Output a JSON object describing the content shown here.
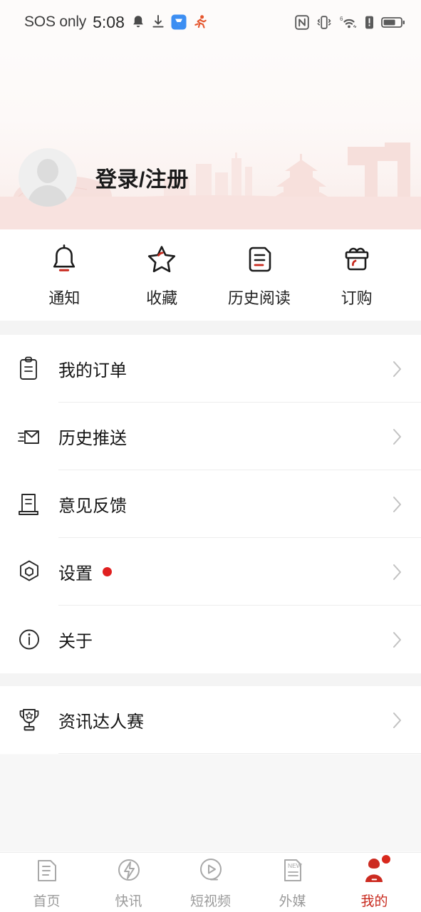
{
  "statusbar": {
    "carrier": "SOS only",
    "time": "5:08",
    "left_icons": [
      "bell-icon",
      "download-icon",
      "app-badge-icon",
      "running-icon"
    ],
    "right_icons": [
      "nfc-icon",
      "vibrate-icon",
      "wifi6-icon",
      "signal-alert-icon",
      "battery-icon"
    ],
    "wifi_generation": "6"
  },
  "header": {
    "login_label": "登录/注册",
    "avatar_icon": "default-avatar-icon",
    "background_art": "beijing-skyline-silhouette",
    "accent_color": "#f8e2df"
  },
  "quick_actions": [
    {
      "label": "通知",
      "icon": "bell-icon"
    },
    {
      "label": "收藏",
      "icon": "star-icon"
    },
    {
      "label": "历史阅读",
      "icon": "document-lines-icon"
    },
    {
      "label": "订购",
      "icon": "gift-icon"
    }
  ],
  "menu_group_1": [
    {
      "label": "我的订单",
      "icon": "clipboard-icon",
      "badge": false
    },
    {
      "label": "历史推送",
      "icon": "envelope-icon",
      "badge": false
    },
    {
      "label": "意见反馈",
      "icon": "feedback-document-icon",
      "badge": false
    },
    {
      "label": "设置",
      "icon": "settings-hexagon-icon",
      "badge": true
    },
    {
      "label": "关于",
      "icon": "info-circle-icon",
      "badge": false
    }
  ],
  "menu_group_2": [
    {
      "label": "资讯达人赛",
      "icon": "trophy-icon",
      "badge": false
    }
  ],
  "tabbar": [
    {
      "label": "首页",
      "icon": "home-document-icon",
      "active": false
    },
    {
      "label": "快讯",
      "icon": "flash-circle-icon",
      "active": false
    },
    {
      "label": "短视频",
      "icon": "play-circle-icon",
      "active": false
    },
    {
      "label": "外媒",
      "icon": "new-document-icon",
      "active": false
    },
    {
      "label": "我的",
      "icon": "profile-person-icon",
      "active": true,
      "badge": true
    }
  ],
  "colors": {
    "brand_red": "#c8291d",
    "accent_red": "#d8281c",
    "badge_red": "#e02020",
    "icon_dark": "#1c1c1c",
    "text_muted": "#9b9b9b",
    "divider": "#ededed",
    "page_bg": "#f7f7f7"
  }
}
